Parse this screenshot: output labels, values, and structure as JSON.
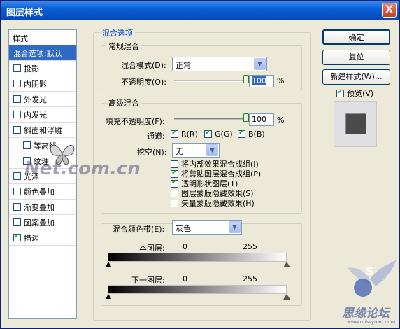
{
  "window": {
    "title": "图层样式",
    "close_glyph": "X"
  },
  "styles_list": {
    "header": "样式",
    "items": [
      {
        "label": "混合选项:默认",
        "has_checkbox": false,
        "checked": false,
        "selected": true,
        "indent": false
      },
      {
        "label": "投影",
        "has_checkbox": true,
        "checked": false,
        "selected": false,
        "indent": false
      },
      {
        "label": "内阴影",
        "has_checkbox": true,
        "checked": false,
        "selected": false,
        "indent": false
      },
      {
        "label": "外发光",
        "has_checkbox": true,
        "checked": false,
        "selected": false,
        "indent": false
      },
      {
        "label": "内发光",
        "has_checkbox": true,
        "checked": false,
        "selected": false,
        "indent": false
      },
      {
        "label": "斜面和浮雕",
        "has_checkbox": true,
        "checked": false,
        "selected": false,
        "indent": false
      },
      {
        "label": "等高线",
        "has_checkbox": true,
        "checked": false,
        "selected": false,
        "indent": true
      },
      {
        "label": "纹理",
        "has_checkbox": true,
        "checked": false,
        "selected": false,
        "indent": true
      },
      {
        "label": "光泽",
        "has_checkbox": true,
        "checked": false,
        "selected": false,
        "indent": false
      },
      {
        "label": "颜色叠加",
        "has_checkbox": true,
        "checked": false,
        "selected": false,
        "indent": false
      },
      {
        "label": "渐变叠加",
        "has_checkbox": true,
        "checked": false,
        "selected": false,
        "indent": false
      },
      {
        "label": "图案叠加",
        "has_checkbox": true,
        "checked": false,
        "selected": false,
        "indent": false
      },
      {
        "label": "描边",
        "has_checkbox": true,
        "checked": true,
        "selected": false,
        "indent": false
      }
    ]
  },
  "blend_options": {
    "title": "混合选项",
    "general": {
      "title": "常规混合",
      "blend_mode_label": "混合模式(D):",
      "blend_mode_value": "正常",
      "opacity_label": "不透明度(O):",
      "opacity_value": "100",
      "opacity_unit": "%",
      "opacity_level": 1.0
    },
    "advanced": {
      "title": "高级混合",
      "fill_opacity_label": "填充不透明度(F):",
      "fill_opacity_value": "100",
      "fill_opacity_unit": "%",
      "fill_opacity_level": 1.0,
      "channels_label": "通道:",
      "channels": [
        {
          "label": "R(R)",
          "checked": true
        },
        {
          "label": "G(G)",
          "checked": true
        },
        {
          "label": "B(B)",
          "checked": true
        }
      ],
      "knockout_label": "挖空(N):",
      "knockout_value": "无",
      "options": [
        {
          "label": "将内部效果混合成组(I)",
          "checked": false
        },
        {
          "label": "将剪贴图层混合成组(P)",
          "checked": true
        },
        {
          "label": "透明形状图层(T)",
          "checked": true
        },
        {
          "label": "图层蒙版隐藏效果(S)",
          "checked": false
        },
        {
          "label": "矢量蒙版隐藏效果(H)",
          "checked": false
        }
      ]
    },
    "blend_if": {
      "label": "混合颜色带(E):",
      "value": "灰色",
      "this_layer_label": "本图层:",
      "this_layer_min": "0",
      "this_layer_max": "255",
      "underlying_label": "下一图层:",
      "underlying_min": "0",
      "underlying_max": "255"
    }
  },
  "buttons": {
    "ok": "确定",
    "reset": "复位",
    "new_style": "新建样式(W)...",
    "preview_label": "预览(V)",
    "preview_checked": true
  },
  "watermarks": {
    "left": "Net.com.cn",
    "right_big": "S",
    "right_text": "思缘论坛",
    "right_url": "www.missyuan.com"
  }
}
